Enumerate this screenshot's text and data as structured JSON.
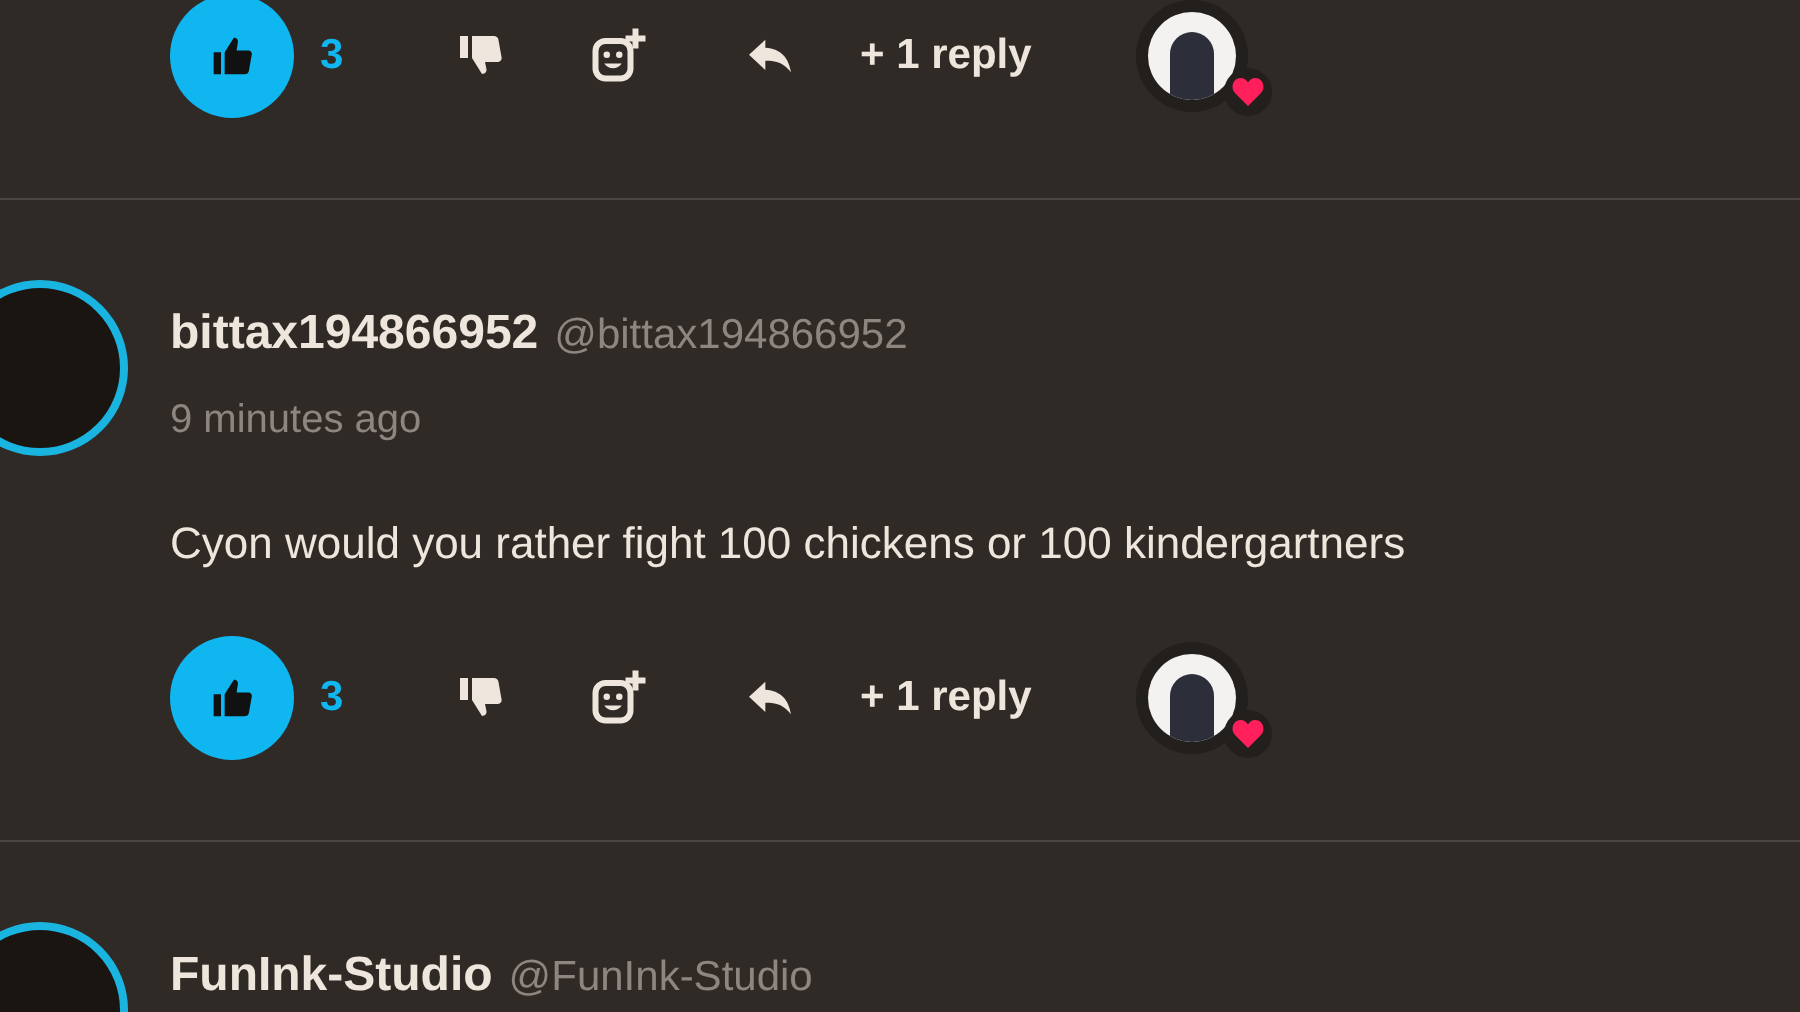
{
  "comments": [
    {
      "actions": {
        "liked": true,
        "likes": "3",
        "replies": "+ 1 reply",
        "creator_hearted": true
      }
    },
    {
      "author": {
        "name": "bittax194866952",
        "handle": "@bittax194866952"
      },
      "time": "9 minutes ago",
      "text": "Cyon would you rather fight 100 chickens or 100 kindergartners",
      "actions": {
        "liked": true,
        "likes": "3",
        "replies": "+ 1 reply",
        "creator_hearted": true
      }
    },
    {
      "author": {
        "name": "FunInk-Studio",
        "handle": "@FunInk-Studio"
      }
    }
  ]
}
